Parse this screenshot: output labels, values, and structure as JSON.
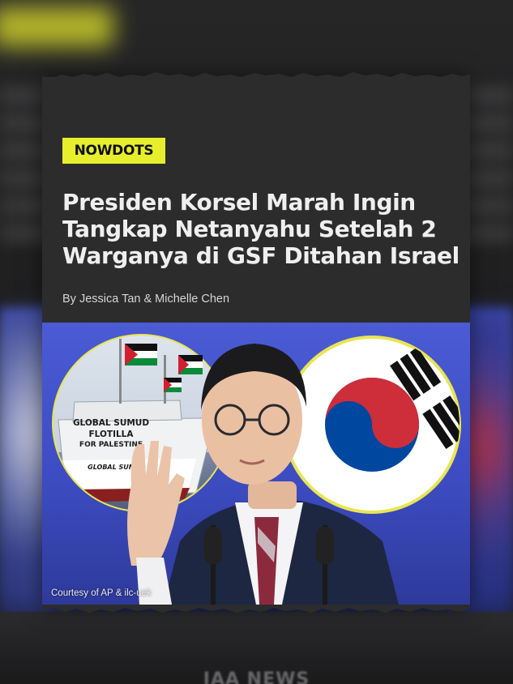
{
  "badge": {
    "label": "NOWDOTS"
  },
  "article": {
    "headline_lines": [
      "Presiden Korsel Marah Ingin",
      "Tangkap Netanyahu Setelah 2",
      "Warganya di GSF Ditahan Israel"
    ],
    "byline": "By Jessica Tan & Michelle Chen"
  },
  "photo": {
    "ship_text": [
      "GLOBAL SUMUD",
      "FLOTILLA",
      "FOR PALESTINE"
    ],
    "ship_hull_text": "GLOBAL SUMUD",
    "caption": "Courtesy of AP & ilc-uek"
  },
  "watermark": {
    "text": "IAA NEWS"
  },
  "colors": {
    "badge_bg": "#e7ef2c",
    "card_bg": "#2c2c2d",
    "photo_bg": "#4a5bd4",
    "flag_red": "#cd2e3a",
    "flag_blue": "#0047a0"
  },
  "icons": [
    "palestine-flag-icon",
    "korea-flag-icon"
  ]
}
